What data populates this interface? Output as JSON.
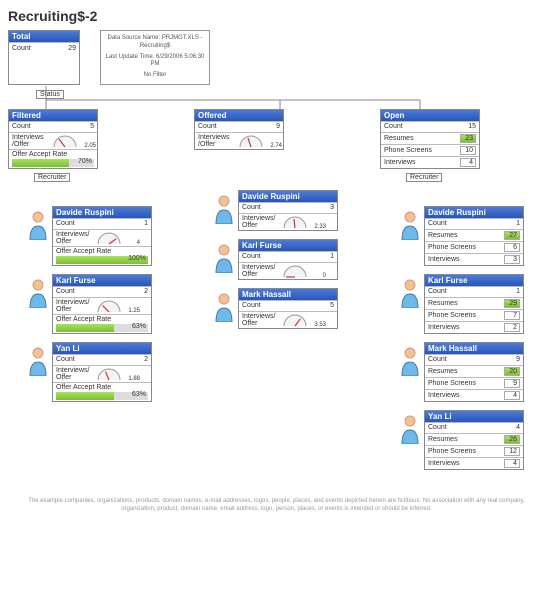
{
  "title": "Recruiting$-2",
  "total": {
    "label": "Total",
    "count_label": "Count",
    "count": 29
  },
  "info": {
    "line1": "Data Source Name: PRJMGT.XLS - Recruiting$",
    "line2": "Last Update Time: 6/29/2006 5:06:30 PM",
    "line3": "No Filter"
  },
  "status_tag": "Status",
  "recruiter_tag": "Recruiter",
  "columns": {
    "filtered": {
      "title": "Filtered",
      "count_label": "Count",
      "count": 5,
      "ratio_label": "Interviews /Offer",
      "ratio": 2.05,
      "rate_label": "Offer Accept Rate",
      "rate": "70%",
      "children": [
        {
          "name": "Davide Ruspini",
          "count_label": "Count",
          "count": 1,
          "ratio_label": "Interviews/ Offer",
          "ratio": 4,
          "rate_label": "Offer Accept Rate",
          "rate": "100%"
        },
        {
          "name": "Karl Furse",
          "count_label": "Count",
          "count": 2,
          "ratio_label": "Interviews/ Offer",
          "ratio": 1.25,
          "rate_label": "Offer Accept Rate",
          "rate": "63%"
        },
        {
          "name": "Yan Li",
          "count_label": "Count",
          "count": 2,
          "ratio_label": "Interviews/ Offer",
          "ratio": 1.88,
          "rate_label": "Offer Accept Rate",
          "rate": "63%"
        }
      ]
    },
    "offered": {
      "title": "Offered",
      "count_label": "Count",
      "count": 9,
      "ratio_label": "Interviews /Offer",
      "ratio": 2.74,
      "children": [
        {
          "name": "Davide Ruspini",
          "count_label": "Count",
          "count": 3,
          "ratio_label": "Interviews/ Offer",
          "ratio": 2.33
        },
        {
          "name": "Karl Furse",
          "count_label": "Count",
          "count": 1,
          "ratio_label": "Interviews/ Offer",
          "ratio": 0
        },
        {
          "name": "Mark Hassall",
          "count_label": "Count",
          "count": 5,
          "ratio_label": "Interviews/ Offer",
          "ratio": 3.53
        }
      ]
    },
    "open": {
      "title": "Open",
      "count_label": "Count",
      "count": 15,
      "resumes_label": "Resumes",
      "resumes": 23,
      "phone_label": "Phone Screens",
      "phone": 10,
      "interviews_label": "Interviews",
      "interviews": 4,
      "children": [
        {
          "name": "Davide Ruspini",
          "count_label": "Count",
          "count": 1,
          "resumes_label": "Resumes",
          "resumes": 27,
          "phone_label": "Phone Screens",
          "phone": 6,
          "interviews_label": "Interviews",
          "interviews": 3
        },
        {
          "name": "Karl Furse",
          "count_label": "Count",
          "count": 1,
          "resumes_label": "Resumes",
          "resumes": 29,
          "phone_label": "Phone Screens",
          "phone": 7,
          "interviews_label": "Interviews",
          "interviews": 2
        },
        {
          "name": "Mark Hassall",
          "count_label": "Count",
          "count": 9,
          "resumes_label": "Resumes",
          "resumes": 20,
          "phone_label": "Phone Screens",
          "phone": 9,
          "interviews_label": "Interviews",
          "interviews": 4
        },
        {
          "name": "Yan Li",
          "count_label": "Count",
          "count": 4,
          "resumes_label": "Resumes",
          "resumes": 26,
          "phone_label": "Phone Screens",
          "phone": 12,
          "interviews_label": "Interviews",
          "interviews": 4
        }
      ]
    }
  },
  "footer": "The example companies, organizations, products, domain names, e-mail addresses, logos, people, places, and events depicted herein are fictitious. No association with any real company, organization, product, domain name, email address, logo, person, places, or events is intended or should be inferred."
}
